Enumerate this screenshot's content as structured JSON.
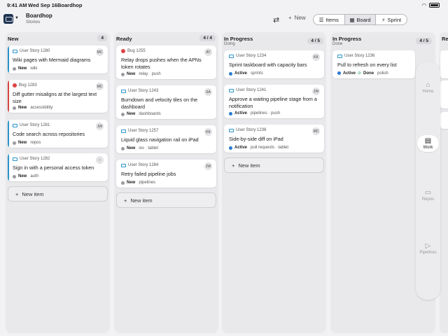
{
  "status": {
    "time": "9:41 AM",
    "date": "Wed Sep 16",
    "app": "Boardhop"
  },
  "header": {
    "title": "Boardhop",
    "subtitle": "Stories",
    "new_label": "New"
  },
  "views": [
    {
      "label": "Items",
      "icon": "list-icon"
    },
    {
      "label": "Board",
      "icon": "board-icon",
      "active": true
    },
    {
      "label": "Sprint",
      "icon": "sprint-icon"
    }
  ],
  "columns": [
    {
      "title": "New",
      "subtitle": "",
      "count": "4",
      "cards": [
        {
          "type": "User Story 1280",
          "kind": "story",
          "avatar": "MC",
          "title": "Wiki pages with Mermaid diagrams",
          "status": "New",
          "tags": "wiki"
        },
        {
          "type": "Bug 1283",
          "kind": "bug",
          "avatar": "MC",
          "title": "Diff gutter misaligns at the largest text size",
          "status": "New",
          "tags": "accessibility"
        },
        {
          "type": "User Story 1281",
          "kind": "story",
          "avatar": "JW",
          "title": "Code search across repositories",
          "status": "New",
          "tags": "repos"
        },
        {
          "type": "User Story 1282",
          "kind": "story",
          "avatar": "–",
          "title": "Sign in with a personal access token",
          "status": "New",
          "tags": "auth"
        }
      ],
      "new_item": "New item"
    },
    {
      "title": "Ready",
      "subtitle": "",
      "count": "4 / 4",
      "cards": [
        {
          "type": "Bug 1255",
          "kind": "bug",
          "avatar": "AT",
          "title": "Relay drops pushes when the APNs token rotates",
          "status": "New",
          "tags": "relay · push"
        },
        {
          "type": "User Story 1243",
          "kind": "story",
          "avatar": "SA",
          "title": "Burndown and velocity tiles on the dashboard",
          "status": "New",
          "tags": "dashboards"
        },
        {
          "type": "User Story 1257",
          "kind": "story",
          "avatar": "KK",
          "title": "Liquid glass navigation rail on iPad",
          "status": "New",
          "tags": "ios · tablet"
        },
        {
          "type": "User Story 1284",
          "kind": "story",
          "avatar": "JW",
          "title": "Retry failed pipeline jobs",
          "status": "New",
          "tags": "pipelines"
        }
      ],
      "new_item": "New item"
    },
    {
      "title": "In Progress",
      "subtitle": "Doing",
      "count": "4 / 5",
      "cards": [
        {
          "type": "User Story 1234",
          "kind": "story",
          "avatar": "KK",
          "title": "Sprint taskboard with capacity bars",
          "status": "Active",
          "tags": "sprints"
        },
        {
          "type": "User Story 1241",
          "kind": "story",
          "avatar": "JW",
          "title": "Approve a waiting pipeline stage from a notification",
          "status": "Active",
          "tags": "pipelines · push"
        },
        {
          "type": "User Story 1238",
          "kind": "story",
          "avatar": "MC",
          "title": "Side-by-side diff on iPad",
          "status": "Active",
          "tags": "pull requests · tablet"
        }
      ],
      "new_item": "New item"
    },
    {
      "title": "In Progress",
      "subtitle": "Done",
      "count": "4 / 5",
      "cards": [
        {
          "type": "User Story 1236",
          "kind": "story",
          "avatar": "",
          "title": "Pull to refresh on every list",
          "status": "Active",
          "done": "Done",
          "tags": "polish"
        }
      ]
    }
  ],
  "peek": {
    "title": "Re"
  },
  "rail": [
    {
      "label": "Home",
      "icon": "home-icon"
    },
    {
      "label": "Work",
      "icon": "work-icon",
      "active": true
    },
    {
      "label": "Repos",
      "icon": "repos-icon"
    },
    {
      "label": "Pipelines",
      "icon": "pipelines-icon"
    }
  ],
  "colors": {
    "story": "#2a93c9",
    "bug": "#d44444",
    "new_dot": "#9a9aa0",
    "active_dot": "#2a7bd0",
    "done_dot": "#2aa86a"
  }
}
